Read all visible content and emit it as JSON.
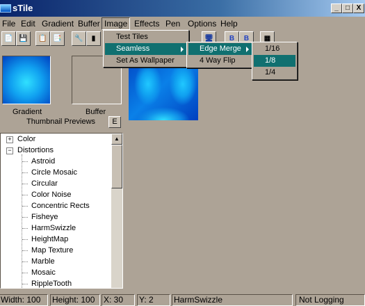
{
  "window": {
    "title": "sTile",
    "minimize": "_",
    "maximize": "□",
    "close": "X"
  },
  "menubar": [
    "File",
    "Edit",
    "Gradient",
    "Buffer",
    "Image",
    "Effects",
    "Pen",
    "Options",
    "Help"
  ],
  "image_menu": {
    "items": [
      "Test Tiles",
      "Seamless",
      "Set As Wallpaper"
    ]
  },
  "seamless_menu": {
    "items": [
      "Edge Merge",
      "4 Way Flip"
    ]
  },
  "edge_merge_menu": {
    "items": [
      "1/16",
      "1/8",
      "1/4"
    ],
    "selected": "1/8"
  },
  "left_panel": {
    "gradient_label": "Gradient",
    "buffer_label": "Buffer",
    "thumbnails_label": "Thumbnail Previews",
    "e_button": "E"
  },
  "tree": {
    "collapsed": "Color",
    "expanded": "Distortions",
    "children": [
      "Astroid",
      "Circle Mosaic",
      "Circular",
      "Color Noise",
      "Concentric Rects",
      "Fisheye",
      "HarmSwizzle",
      "HeightMap",
      "Map Texture",
      "Marble",
      "Mosaic",
      "RippleTooth"
    ]
  },
  "status": {
    "width": "Width: 100",
    "height": "Height: 100",
    "x": "X: 30",
    "y": "Y: 2",
    "effect": "HarmSwizzle",
    "logging": "Not Logging"
  },
  "colors": {
    "highlight": "#107070",
    "face": "#ada396"
  }
}
